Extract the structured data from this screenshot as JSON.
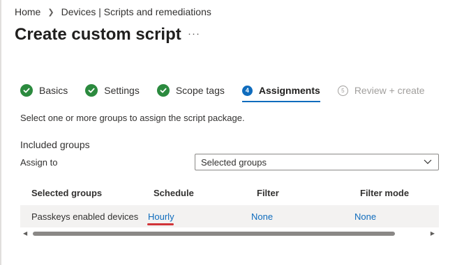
{
  "breadcrumb": {
    "items": [
      "Home",
      "Devices | Scripts and remediations"
    ]
  },
  "page_title": "Create custom script",
  "more_label": "···",
  "wizard": {
    "steps": [
      {
        "label": "Basics",
        "state": "done",
        "marker": ""
      },
      {
        "label": "Settings",
        "state": "done",
        "marker": ""
      },
      {
        "label": "Scope tags",
        "state": "done",
        "marker": ""
      },
      {
        "label": "Assignments",
        "state": "current",
        "marker": "4"
      },
      {
        "label": "Review + create",
        "state": "future",
        "marker": "5"
      }
    ]
  },
  "instruction": "Select one or more groups to assign the script package.",
  "included_groups": {
    "heading": "Included groups",
    "assign_to_label": "Assign to",
    "assign_to_value": "Selected groups"
  },
  "table": {
    "columns": [
      "Selected groups",
      "Schedule",
      "Filter",
      "Filter mode"
    ],
    "rows": [
      {
        "group": "Passkeys enabled devices",
        "schedule": "Hourly",
        "filter": "None",
        "filter_mode": "None"
      }
    ]
  },
  "colors": {
    "accent": "#0f6cbd",
    "done": "#2b8a3e",
    "highlight": "#d13438"
  }
}
